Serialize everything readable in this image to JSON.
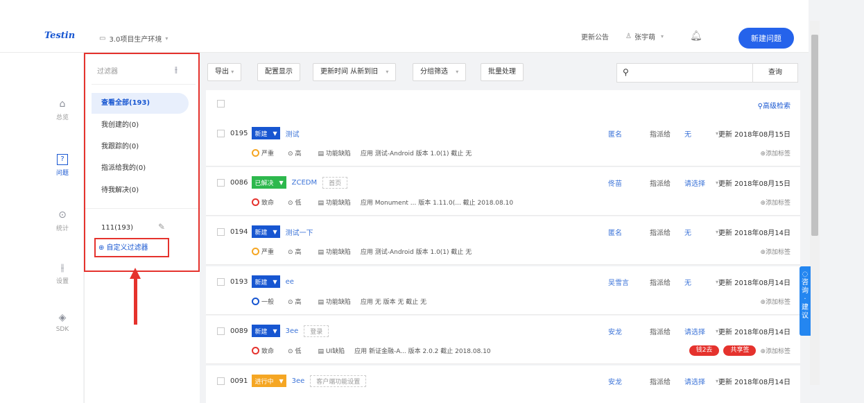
{
  "topbar": {
    "logo": "Testin",
    "project": "3.0项目生产环境",
    "announce": "更新公告",
    "user": "张宇萌",
    "new_issue": "新建问题"
  },
  "nav": [
    {
      "label": "总览",
      "icon": "home-icon"
    },
    {
      "label": "问题",
      "icon": "question-icon"
    },
    {
      "label": "统计",
      "icon": "chart-icon"
    },
    {
      "label": "设置",
      "icon": "settings-icon"
    },
    {
      "label": "SDK",
      "icon": "layers-icon"
    }
  ],
  "filter": {
    "title": "过滤器",
    "items": [
      "查看全部(193)",
      "我创建的(0)",
      "我跟踪的(0)",
      "指派给我的(0)",
      "待我解决(0)"
    ],
    "custom_item": "111(193)",
    "add_custom": "⊕ 自定义过滤器"
  },
  "toolbar": {
    "export": "导出",
    "config": "配置显示",
    "sort": "更新时间 从新到旧",
    "group": "分组筛选",
    "batch": "批量处理",
    "search_btn": "查询",
    "advanced": "高级检索"
  },
  "rows": [
    {
      "id": "0195",
      "status": "新建",
      "status_color": "#1756d1",
      "title": "测试",
      "ghost": "",
      "assignee": "匿名",
      "assign_label": "指派给",
      "assign_to": "无",
      "updated": "更新 2018年08月15日",
      "severity": "严重",
      "sev_color": "#f5a623",
      "priority": "高",
      "type": "功能缺陷",
      "app": "应用 测试-Android  版本 1.0(1)  截止 无",
      "tags": []
    },
    {
      "id": "0086",
      "status": "已解决",
      "status_color": "#2db84d",
      "title": "ZCEDM",
      "ghost": "首页",
      "assignee": "佟苗",
      "assign_label": "指派给",
      "assign_to": "请选择",
      "updated": "更新 2018年08月15日",
      "severity": "致命",
      "sev_color": "#e5322d",
      "priority": "低",
      "type": "功能缺陷",
      "app": "应用 Monument ...  版本 1.11.0(...  截止 2018.08.10",
      "tags": []
    },
    {
      "id": "0194",
      "status": "新建",
      "status_color": "#1756d1",
      "title": "测试一下",
      "ghost": "",
      "assignee": "匿名",
      "assign_label": "指派给",
      "assign_to": "无",
      "updated": "更新 2018年08月14日",
      "severity": "严重",
      "sev_color": "#f5a623",
      "priority": "高",
      "type": "功能缺陷",
      "app": "应用 测试-Android  版本 1.0(1)  截止 无",
      "tags": []
    },
    {
      "id": "0193",
      "status": "新建",
      "status_color": "#1756d1",
      "title": "ee",
      "ghost": "",
      "assignee": "吴雪言",
      "assign_label": "指派给",
      "assign_to": "无",
      "updated": "更新 2018年08月14日",
      "severity": "一般",
      "sev_color": "#1756d1",
      "priority": "高",
      "type": "功能缺陷",
      "app": "应用 无  版本 无  截止 无",
      "tags": []
    },
    {
      "id": "0089",
      "status": "新建",
      "status_color": "#1756d1",
      "title": "3ee",
      "ghost": "登录",
      "assignee": "安龙",
      "assign_label": "指派给",
      "assign_to": "请选择",
      "updated": "更新 2018年08月14日",
      "severity": "致命",
      "sev_color": "#e5322d",
      "priority": "低",
      "type": "UI缺陷",
      "app": "应用 新证金融-A...  版本 2.0.2  截止 2018.08.10",
      "tags": [
        {
          "label": "钱2去",
          "color": "#e5322d"
        },
        {
          "label": "共享签",
          "color": "#e5322d"
        }
      ]
    },
    {
      "id": "0091",
      "status": "进行中",
      "status_color": "#f5a623",
      "title": "3ee",
      "ghost": "客户端功能设置",
      "assignee": "安龙",
      "assign_label": "指派给",
      "assign_to": "请选择",
      "updated": "更新 2018年08月14日",
      "severity": "",
      "sev_color": "#999",
      "priority": "",
      "type": "",
      "app": "",
      "tags": []
    }
  ],
  "add_tag": "⊕添加标签",
  "feedback": "咨询·建议"
}
